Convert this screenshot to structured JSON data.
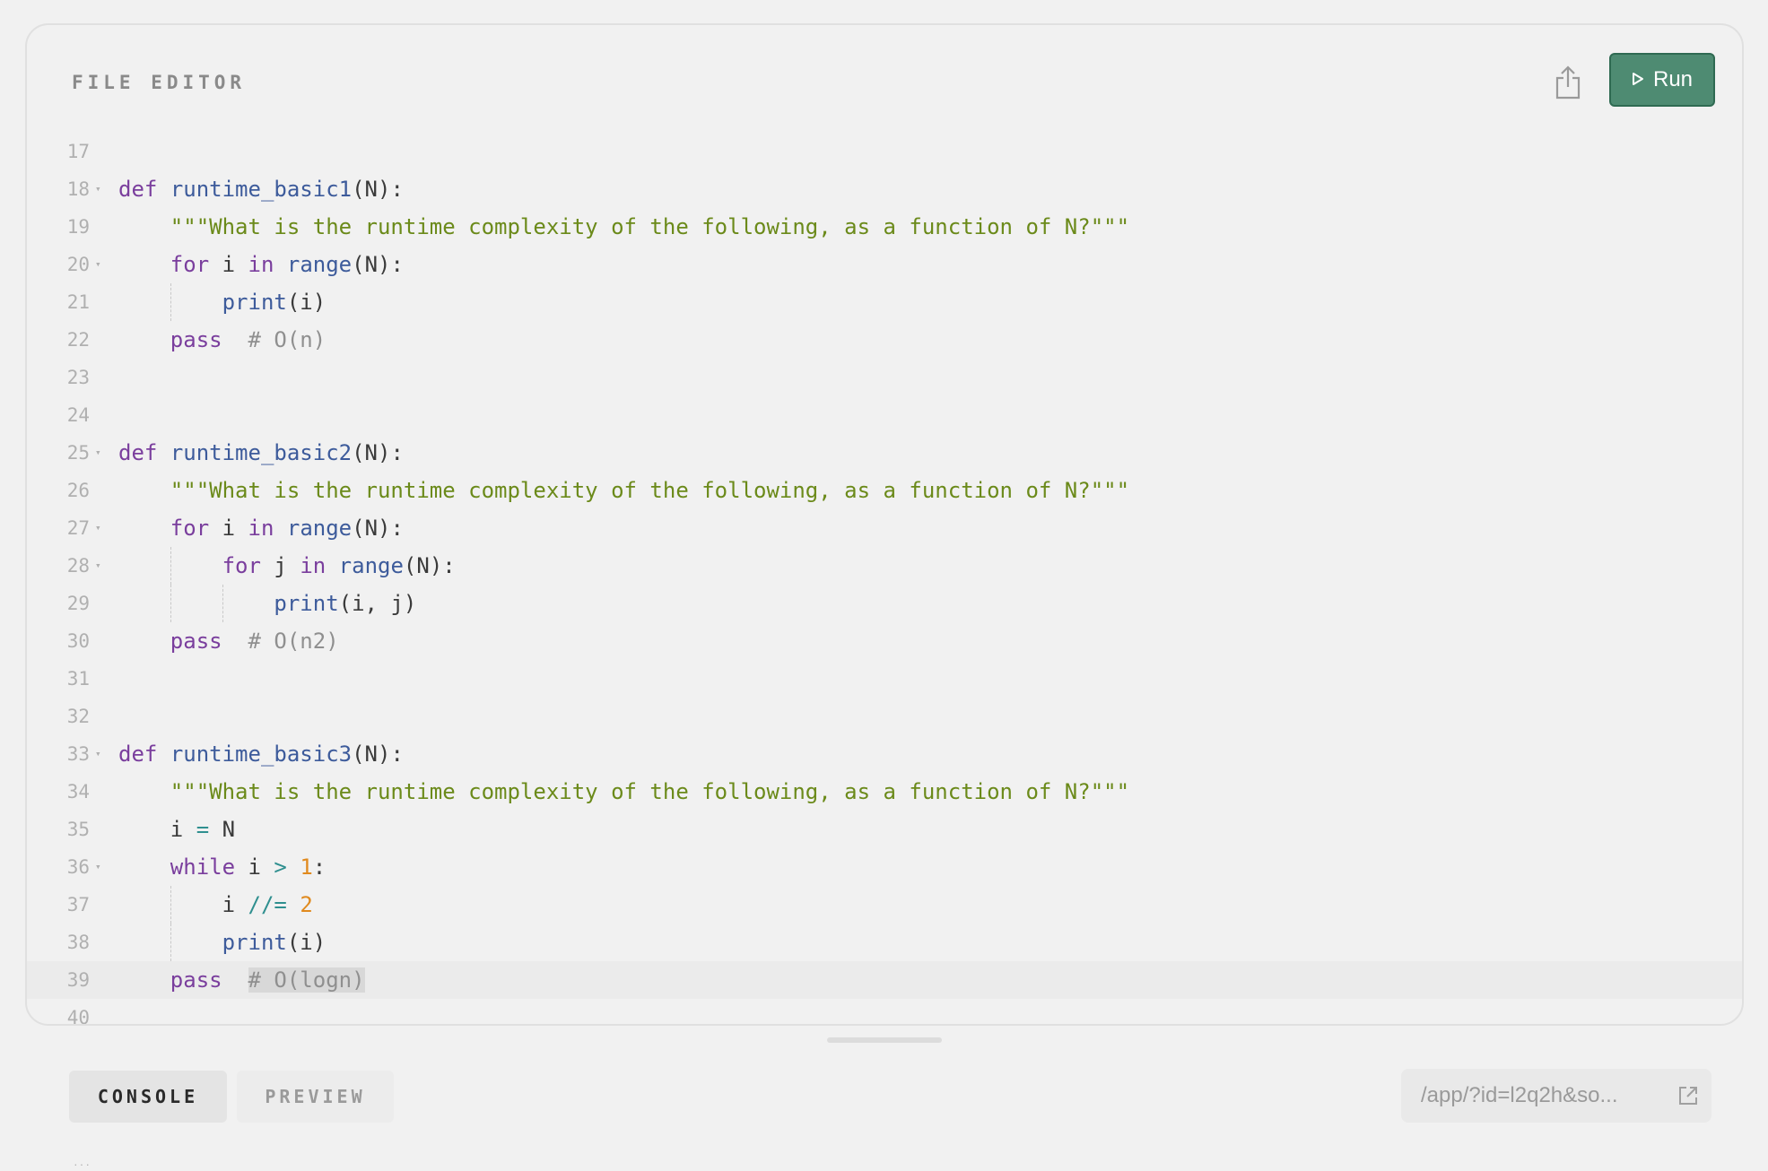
{
  "editor": {
    "title": "FILE EDITOR",
    "run_label": "Run",
    "share_icon": "share-icon",
    "run_icon": "play-icon"
  },
  "code": {
    "lines": [
      {
        "num": "17",
        "fold": false,
        "text": ""
      },
      {
        "num": "18",
        "fold": true,
        "text": "def runtime_basic1(N):"
      },
      {
        "num": "19",
        "fold": false,
        "text": "    \"\"\"What is the runtime complexity of the following, as a function of N?\"\"\""
      },
      {
        "num": "20",
        "fold": true,
        "text": "    for i in range(N):"
      },
      {
        "num": "21",
        "fold": false,
        "text": "        print(i)"
      },
      {
        "num": "22",
        "fold": false,
        "text": "    pass  # O(n)"
      },
      {
        "num": "23",
        "fold": false,
        "text": ""
      },
      {
        "num": "24",
        "fold": false,
        "text": ""
      },
      {
        "num": "25",
        "fold": true,
        "text": "def runtime_basic2(N):"
      },
      {
        "num": "26",
        "fold": false,
        "text": "    \"\"\"What is the runtime complexity of the following, as a function of N?\"\"\""
      },
      {
        "num": "27",
        "fold": true,
        "text": "    for i in range(N):"
      },
      {
        "num": "28",
        "fold": true,
        "text": "        for j in range(N):"
      },
      {
        "num": "29",
        "fold": false,
        "text": "            print(i, j)"
      },
      {
        "num": "30",
        "fold": false,
        "text": "    pass  # O(n2)"
      },
      {
        "num": "31",
        "fold": false,
        "text": ""
      },
      {
        "num": "32",
        "fold": false,
        "text": ""
      },
      {
        "num": "33",
        "fold": true,
        "text": "def runtime_basic3(N):"
      },
      {
        "num": "34",
        "fold": false,
        "text": "    \"\"\"What is the runtime complexity of the following, as a function of N?\"\"\""
      },
      {
        "num": "35",
        "fold": false,
        "text": "    i = N"
      },
      {
        "num": "36",
        "fold": true,
        "text": "    while i > 1:"
      },
      {
        "num": "37",
        "fold": false,
        "text": "        i //= 2"
      },
      {
        "num": "38",
        "fold": false,
        "text": "        print(i)"
      },
      {
        "num": "39",
        "fold": false,
        "text": "    pass  # O(logn)",
        "active": true
      },
      {
        "num": "40",
        "fold": false,
        "text": ""
      }
    ]
  },
  "bottom": {
    "tabs": [
      {
        "label": "CONSOLE",
        "active": true
      },
      {
        "label": "PREVIEW",
        "active": false
      }
    ],
    "url": "/app/?id=l2q2h&so...",
    "url_icon": "external-link-icon",
    "console_partial": "···"
  },
  "colors": {
    "run_button": "#4e8b72",
    "keyword": "#7a3e9d",
    "function": "#3d5b9b",
    "string": "#6b8a1a",
    "comment": "#8f8f8f",
    "number": "#e08a1e"
  }
}
